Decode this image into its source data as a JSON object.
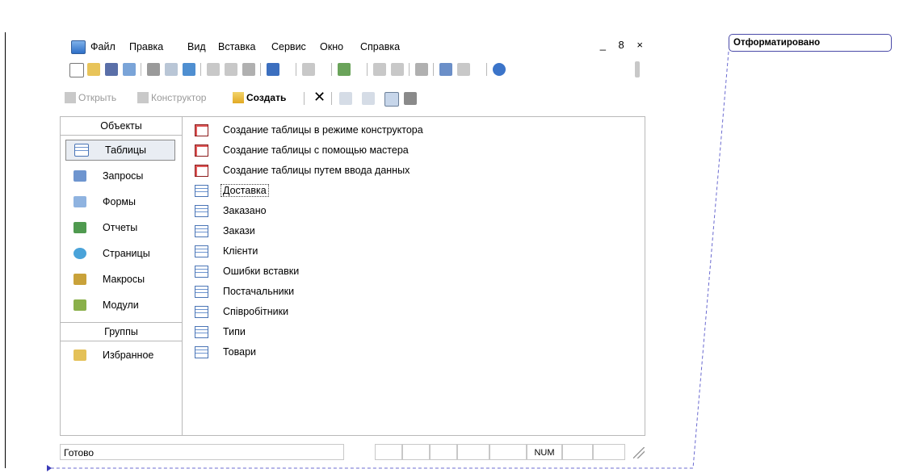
{
  "menubar": {
    "items": [
      "Файл",
      "Правка",
      "Вид",
      "Вставка",
      "Сервис",
      "Окно",
      "Справка"
    ],
    "window_controls": "_ 8 ×"
  },
  "db_toolbar": {
    "open": "Открыть",
    "design": "Конструктор",
    "create": "Создать"
  },
  "objects_pane": {
    "header": "Объекты",
    "items": [
      "Таблицы",
      "Запросы",
      "Формы",
      "Отчеты",
      "Страницы",
      "Макросы",
      "Модули"
    ],
    "selected": "Таблицы",
    "groups_header": "Группы",
    "groups": [
      "Избранное"
    ]
  },
  "list": {
    "items": [
      {
        "label": "Создание таблицы в режиме конструктора",
        "icon": "wizard-icon"
      },
      {
        "label": "Создание таблицы с помощью мастера",
        "icon": "wizard-icon"
      },
      {
        "label": "Создание таблицы путем ввода данных",
        "icon": "wizard-icon"
      },
      {
        "label": "Доставка",
        "icon": "table-icon"
      },
      {
        "label": "Заказано",
        "icon": "table-icon"
      },
      {
        "label": "Закази",
        "icon": "table-icon"
      },
      {
        "label": "Клієнти",
        "icon": "table-icon"
      },
      {
        "label": "Ошибки вставки",
        "icon": "table-icon"
      },
      {
        "label": "Постачальники",
        "icon": "table-icon"
      },
      {
        "label": "Співробітники",
        "icon": "table-icon"
      },
      {
        "label": "Типи",
        "icon": "table-icon"
      },
      {
        "label": "Товари",
        "icon": "table-icon"
      }
    ],
    "focused": "Доставка"
  },
  "statusbar": {
    "text": "Готово",
    "num": "NUM"
  },
  "comment": {
    "text": "Отформатировано"
  }
}
